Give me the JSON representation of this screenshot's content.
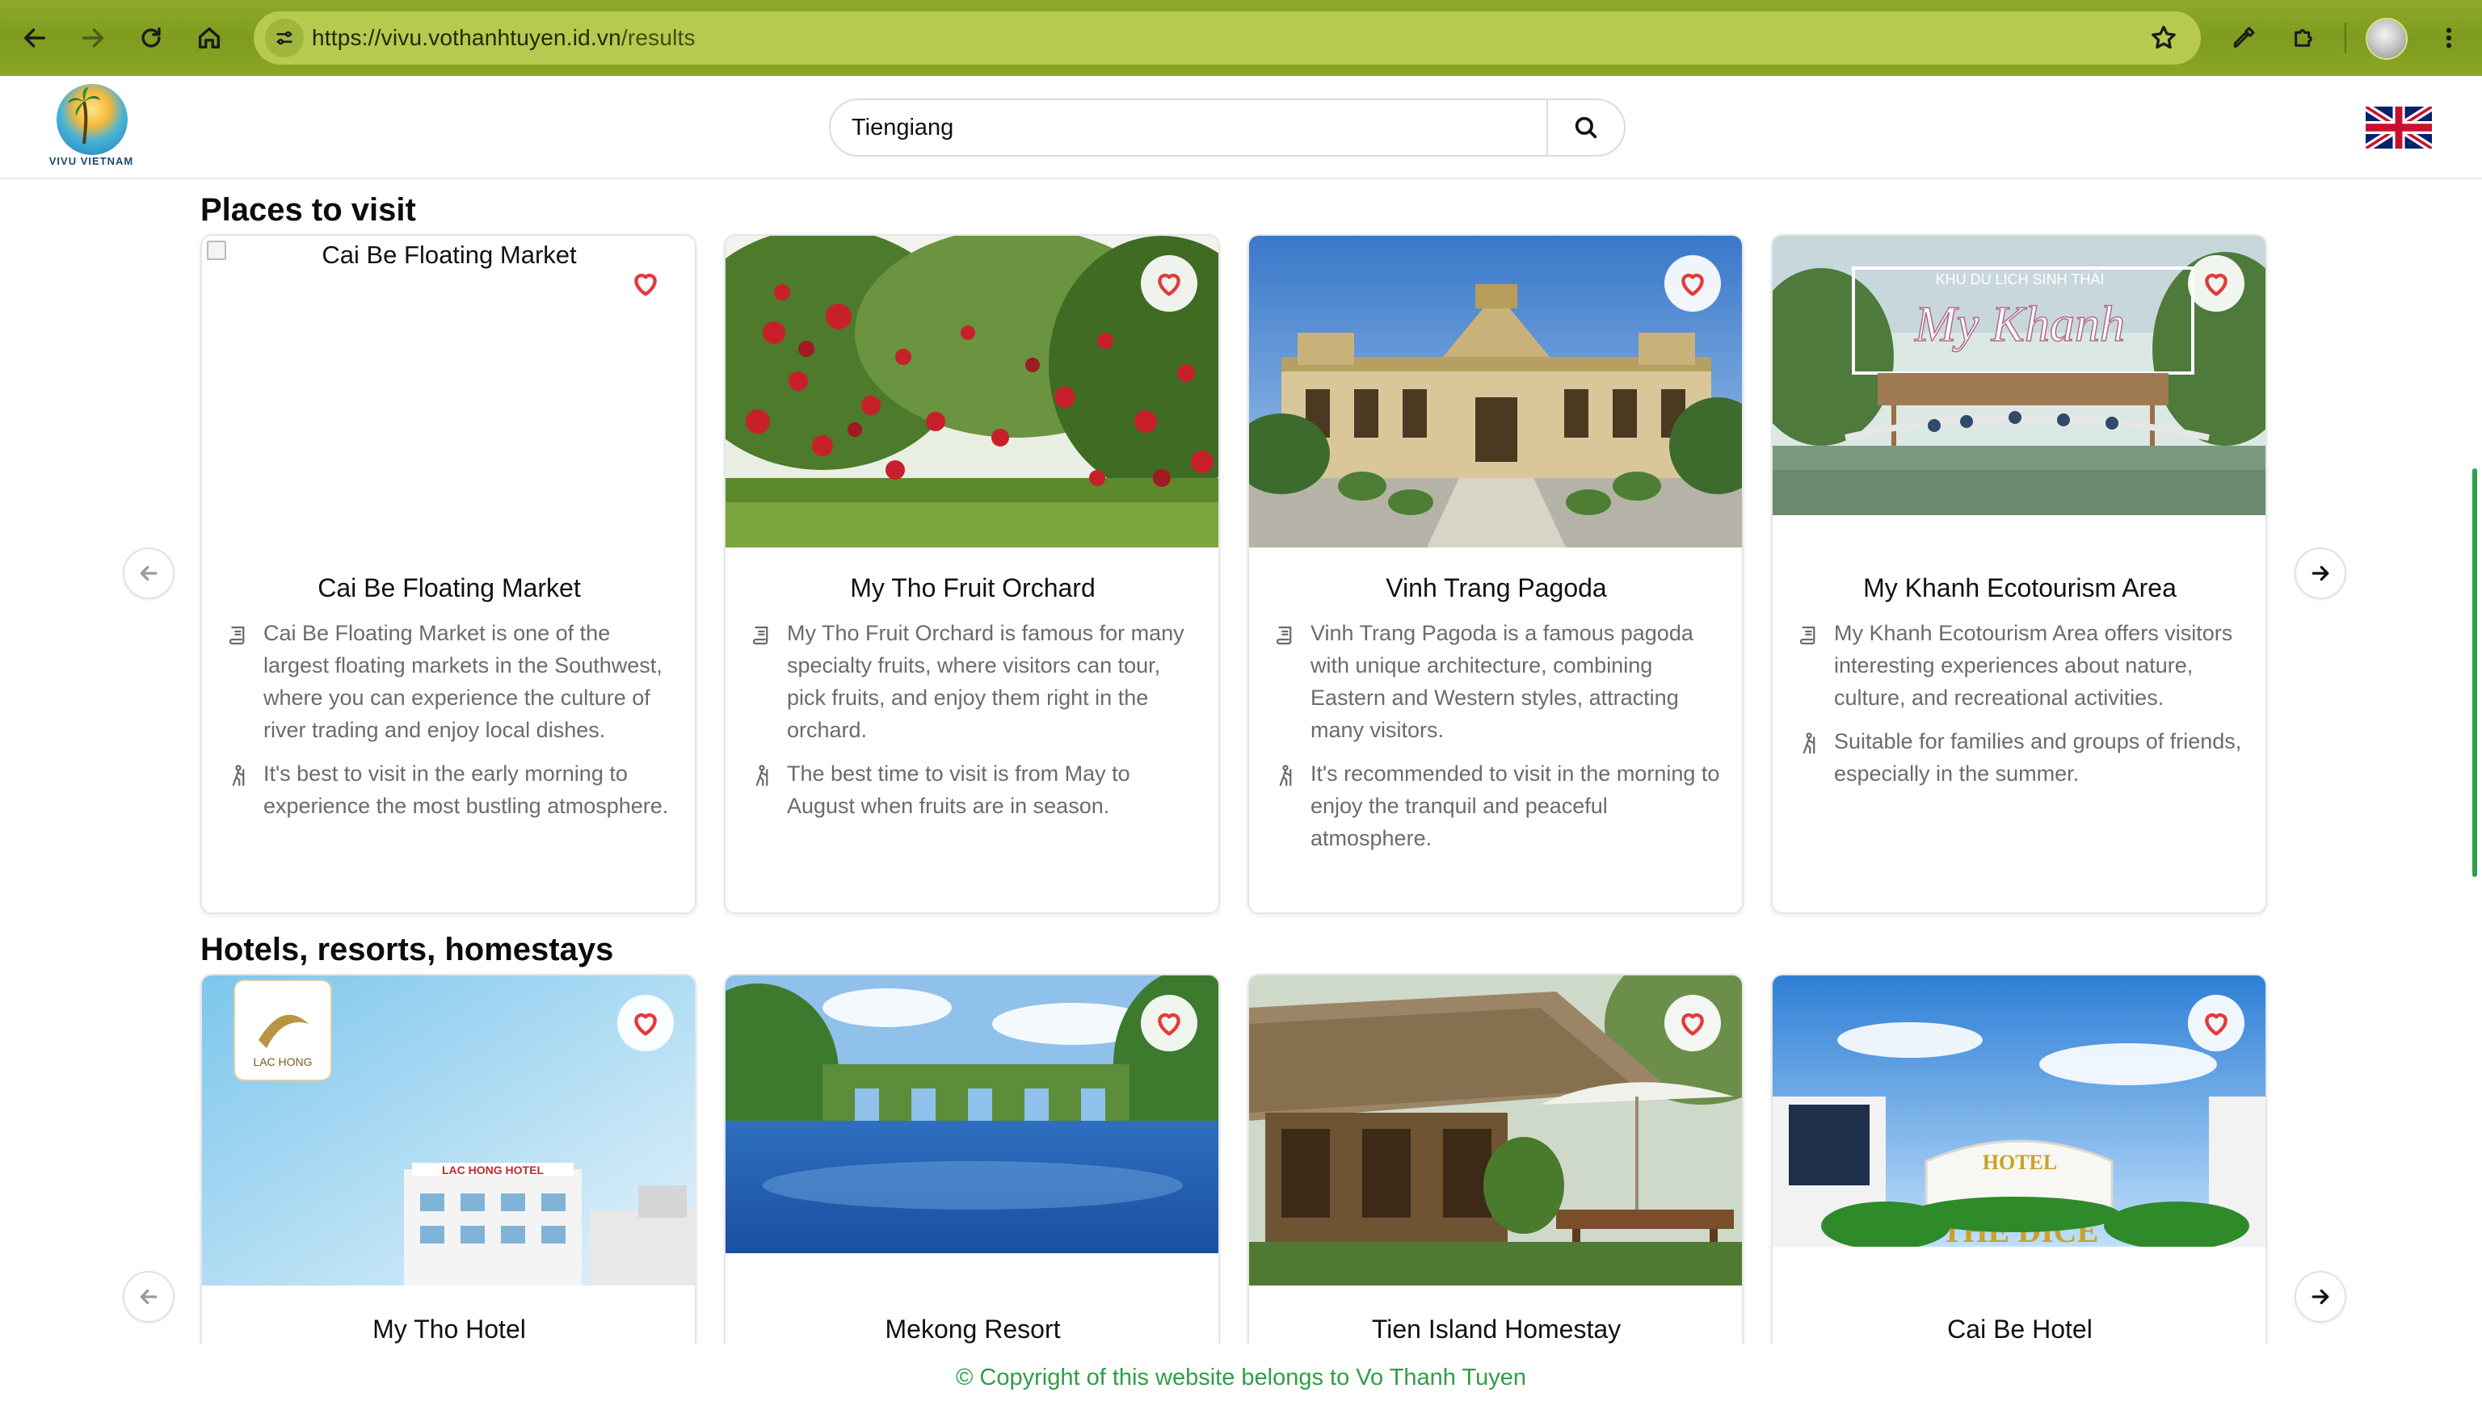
{
  "browser": {
    "url_host": "https://vivu.vothanhtuyen.id.vn",
    "url_path": "/results",
    "nav_icons": [
      "back-arrow-icon",
      "forward-arrow-icon",
      "reload-icon",
      "home-icon"
    ],
    "toolbar_icons": [
      "bookmark-star-icon",
      "eyedropper-icon",
      "extensions-puzzle-icon",
      "profile-avatar",
      "more-vert-icon"
    ],
    "theme_color": "#8ea82a"
  },
  "header": {
    "logo_text": "VIVU VIETNAM",
    "search_value": "Tiengiang",
    "search_icon": "search-icon",
    "language_icon": "uk-flag-icon"
  },
  "sections": {
    "places": {
      "title": "Places to visit",
      "cards": [
        {
          "name": "Cai Be Floating Market",
          "image_alt": "Cai Be Floating Market",
          "description": "Cai Be Floating Market is one of the largest floating markets in the Southwest, where you can experience the culture of river trading and enjoy local dishes.",
          "tip": "It's best to visit in the early morning to experience the most bustling atmosphere."
        },
        {
          "name": "My Tho Fruit Orchard",
          "description": "My Tho Fruit Orchard is famous for many specialty fruits, where visitors can tour, pick fruits, and enjoy them right in the orchard.",
          "tip": "The best time to visit is from May to August when fruits are in season."
        },
        {
          "name": "Vinh Trang Pagoda",
          "description": "Vinh Trang Pagoda is a famous pagoda with unique architecture, combining Eastern and Western styles, attracting many visitors.",
          "tip": "It's recommended to visit in the morning to enjoy the tranquil and peaceful atmosphere."
        },
        {
          "name": "My Khanh Ecotourism Area",
          "image_banner_top": "KHU DU LỊCH SINH THÁI",
          "image_banner_main": "My Khanh",
          "description": "My Khanh Ecotourism Area offers visitors interesting experiences about nature, culture, and recreational activities.",
          "tip": "Suitable for families and groups of friends, especially in the summer."
        }
      ]
    },
    "hotels": {
      "title": "Hotels, resorts, homestays",
      "cards": [
        {
          "name": "My Tho Hotel",
          "image_sign": "LAC HONG HOTEL",
          "image_logo": "LAC HONG"
        },
        {
          "name": "Mekong Resort"
        },
        {
          "name": "Tien Island Homestay"
        },
        {
          "name": "Cai Be Hotel",
          "image_sign_top": "HOTEL",
          "image_sign_bottom": "THE DICE"
        }
      ]
    }
  },
  "footer": {
    "text": "© Copyright of this website belongs to Vo Thanh Tuyen"
  },
  "colors": {
    "heart": "#e43a3a",
    "footer_text": "#2f9e44",
    "scrollbar": "#2aa14a"
  }
}
